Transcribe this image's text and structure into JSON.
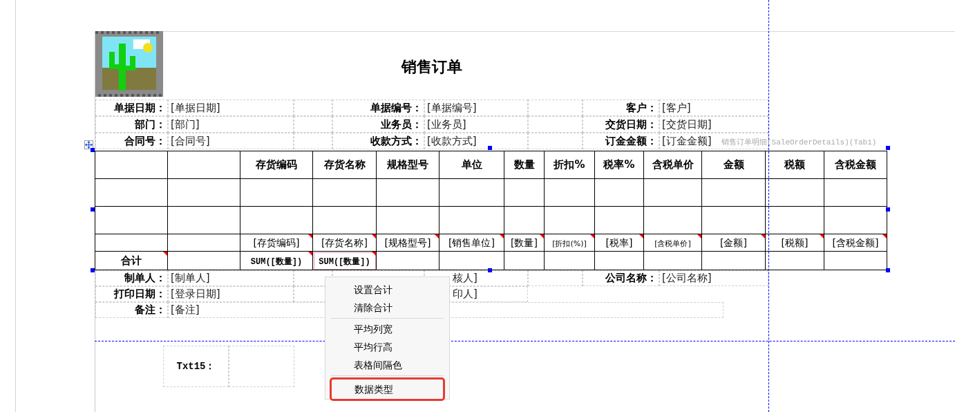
{
  "report": {
    "title": "销售订单",
    "header_rows": [
      [
        {
          "label": "单据日期：",
          "value": "[单据日期]"
        },
        {
          "label": "单据编号：",
          "value": "[单据编号]"
        },
        {
          "label": "客户：",
          "value": "[客户]"
        }
      ],
      [
        {
          "label": "部门：",
          "value": "[部门]"
        },
        {
          "label": "业务员：",
          "value": "[业务员]"
        },
        {
          "label": "交货日期：",
          "value": "[交货日期]"
        }
      ],
      [
        {
          "label": "合同号：",
          "value": "[合同号]"
        },
        {
          "label": "收款方式：",
          "value": "[收款方式]"
        },
        {
          "label": "订金金额：",
          "value": "[订金金额]"
        }
      ]
    ],
    "detail_table": {
      "caption": "销售订单明细(SaleOrderDetails)(Tab1)",
      "columns": [
        null,
        null,
        "存货编码",
        "存货名称",
        "规格型号",
        "单位",
        "数量",
        "折扣%",
        "税率%",
        "含税单价",
        "金额",
        "税额",
        "含税金额"
      ],
      "field_row": [
        {
          "marked": false
        },
        {
          "marked": false
        },
        {
          "text": "[存货编码]",
          "marked": true
        },
        {
          "text": "[存货名称]",
          "marked": true
        },
        {
          "text": "[规格型号]",
          "marked": true
        },
        {
          "text": "[销售单位]",
          "marked": true
        },
        {
          "text": "[数量]",
          "marked": true
        },
        {
          "text": "[折扣(%)]",
          "marked": true
        },
        {
          "text": "[税率]",
          "marked": true
        },
        {
          "text": "[含税单价]",
          "marked": true
        },
        {
          "text": "[金额]",
          "marked": true
        },
        {
          "text": "[税额]",
          "marked": true
        },
        {
          "text": "[含税金额]",
          "marked": true
        }
      ],
      "total_row": [
        {
          "text": "合计",
          "marked": true,
          "selected": false
        },
        {
          "marked": false,
          "selected": false
        },
        {
          "text": "SUM([数量])",
          "marked": true,
          "selected": false
        },
        {
          "text": "SUM([数量])",
          "marked": true,
          "selected": true
        },
        {
          "marked": false,
          "selected": false
        },
        {
          "marked": false,
          "selected": false
        },
        {
          "marked": false,
          "selected": false
        },
        {
          "marked": false,
          "selected": false
        },
        {
          "marked": false,
          "selected": false
        },
        {
          "marked": false,
          "selected": false
        },
        {
          "marked": false,
          "selected": false
        },
        {
          "marked": false,
          "selected": false
        },
        {
          "marked": false,
          "selected": false
        }
      ]
    },
    "footer_rows": [
      [
        {
          "label": "制单人：",
          "value": "[制单人]"
        },
        {
          "value": "核人]"
        },
        {
          "label": "公司名称：",
          "value": "[公司名称]"
        }
      ],
      [
        {
          "label": "打印日期：",
          "value": "[登录日期]"
        },
        {
          "value": "印人]"
        }
      ],
      [
        {
          "label": "备注：",
          "value": "[备注]"
        }
      ]
    ],
    "text_box": {
      "label": "Txt15："
    }
  },
  "context_menu": {
    "groups": [
      [
        {
          "label": "设置合计",
          "highlighted": false
        },
        {
          "label": "清除合计",
          "highlighted": false
        }
      ],
      [
        {
          "label": "平均列宽",
          "highlighted": false
        },
        {
          "label": "平均行高",
          "highlighted": false
        },
        {
          "label": "表格间隔色",
          "highlighted": false
        }
      ],
      [
        {
          "label": "数据类型",
          "highlighted": true
        }
      ]
    ]
  }
}
